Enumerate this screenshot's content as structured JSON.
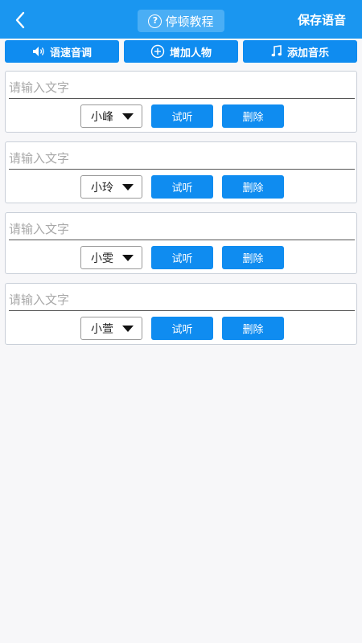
{
  "header": {
    "tutorial_label": "停顿教程",
    "save_label": "保存语音"
  },
  "toolbar": [
    {
      "label": "语速音调",
      "icon": "speaker-icon"
    },
    {
      "label": "增加人物",
      "icon": "plus-circle-icon"
    },
    {
      "label": "添加音乐",
      "icon": "music-note-icon"
    }
  ],
  "cards": [
    {
      "placeholder": "请输入文字",
      "voice": "小峰",
      "listen_label": "试听",
      "delete_label": "删除"
    },
    {
      "placeholder": "请输入文字",
      "voice": "小玲",
      "listen_label": "试听",
      "delete_label": "删除"
    },
    {
      "placeholder": "请输入文字",
      "voice": "小雯",
      "listen_label": "试听",
      "delete_label": "删除"
    },
    {
      "placeholder": "请输入文字",
      "voice": "小萱",
      "listen_label": "试听",
      "delete_label": "删除"
    }
  ],
  "colors": {
    "header": "#1a96f0",
    "button": "#0f8cf0",
    "background": "#f7f7f9"
  }
}
